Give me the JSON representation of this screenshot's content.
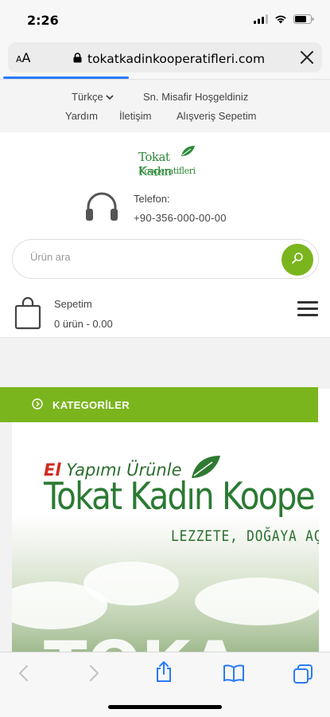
{
  "status_bar": {
    "time": "2:26"
  },
  "browser": {
    "text_size_label_small": "A",
    "text_size_label_large": "A",
    "url": "tokatkadinkooperatifleri.com"
  },
  "top_links": {
    "language": "Türkçe",
    "welcome": "Sn. Misafir Hoşgeldiniz",
    "help": "Yardım",
    "contact": "İletişim",
    "cart": "Alışveriş Sepetim"
  },
  "header": {
    "logo_line1": "Tokat Kadın",
    "logo_line2": "Kooperatifleri",
    "phone_label": "Telefon:",
    "phone_value": "+90-356-000-00-00",
    "search_placeholder": "Ürün ara",
    "cart_label": "Sepetim",
    "cart_value": "0 ürün - 0.00"
  },
  "categories": {
    "label": "KATEGORİLER"
  },
  "banner": {
    "top_prefix": "El",
    "top_rest": " Yapımı Ürünle",
    "main": "Tokat Kadın Koope",
    "sub": "LEZZETE, DOĞAYA AÇILAN",
    "big": "TOKA"
  },
  "colors": {
    "accent": "#7ab51d",
    "brand_green": "#2b7a33",
    "link_blue": "#2a7bf6"
  },
  "icons": [
    "signal-icon",
    "wifi-icon",
    "battery-icon",
    "lock-icon",
    "close-icon",
    "chevron-down-icon",
    "headphones-icon",
    "search-icon",
    "shopping-bag-icon",
    "hamburger-menu-icon",
    "circle-arrow-icon",
    "leaf-icon",
    "back-icon",
    "forward-icon",
    "share-icon",
    "bookmarks-icon",
    "tabs-icon"
  ]
}
